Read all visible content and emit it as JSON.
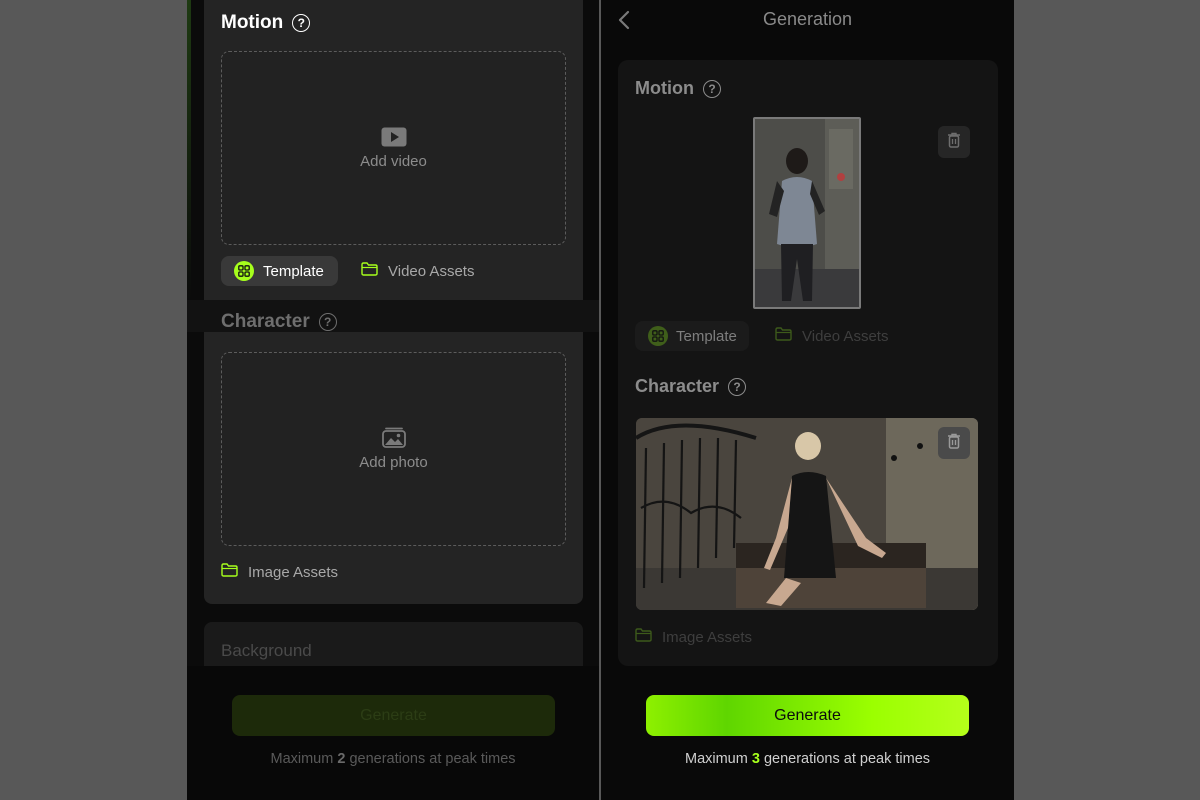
{
  "left_screen": {
    "motion": {
      "title": "Motion",
      "dropzone_label": "Add video",
      "template_label": "Template",
      "assets_label": "Video Assets"
    },
    "character": {
      "title": "Character",
      "dropzone_label": "Add photo",
      "assets_label": "Image Assets"
    },
    "background": {
      "title": "Background"
    },
    "generate_label": "Generate",
    "limit": {
      "prefix": "Maximum ",
      "count": "2",
      "suffix": " generations at peak times"
    }
  },
  "right_screen": {
    "header_title": "Generation",
    "motion": {
      "title": "Motion",
      "template_label": "Template",
      "assets_label": "Video Assets"
    },
    "character": {
      "title": "Character",
      "assets_label": "Image Assets"
    },
    "generate_label": "Generate",
    "limit": {
      "prefix": "Maximum ",
      "count": "3",
      "suffix": " generations at peak times"
    }
  },
  "colors": {
    "accent": "#a6ff1c",
    "panel": "#242424",
    "background": "#585858"
  },
  "icons": [
    "help-icon",
    "video-icon",
    "photo-icon",
    "template-icon",
    "folder-icon",
    "back-chevron-icon",
    "trash-icon"
  ]
}
